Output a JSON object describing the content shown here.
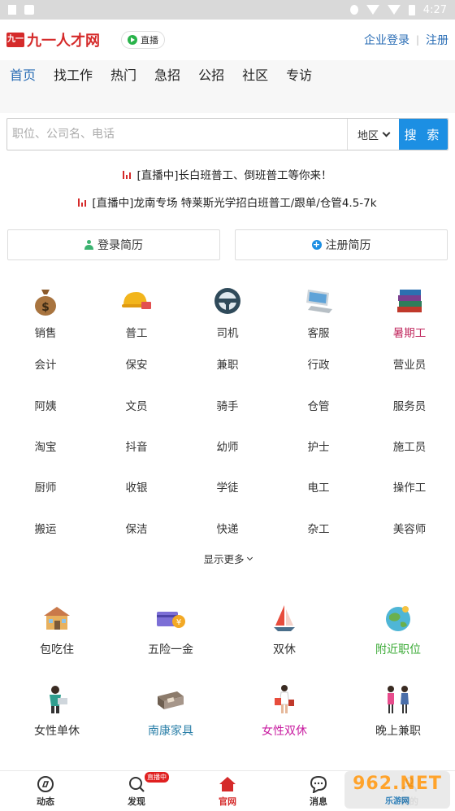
{
  "status_bar": {
    "time": "4:27"
  },
  "header": {
    "logo_mark": "九一",
    "logo_text": "九一人才网",
    "live_label": "直播",
    "company_login": "企业登录",
    "separator": "|",
    "register": "注册"
  },
  "nav": [
    "首页",
    "找工作",
    "热门",
    "急招",
    "公招",
    "社区",
    "专访"
  ],
  "search": {
    "placeholder": "职位、公司名、电话",
    "region_label": "地区",
    "button_label": "搜 索"
  },
  "broadcasts": [
    "[直播中]长白班普工、倒班普工等你来！",
    "[直播中]龙南专场 特莱斯光学招白班普工/跟单/仓管4.5-7k"
  ],
  "resume": {
    "login": "登录简历",
    "register": "注册简历"
  },
  "icon_categories": [
    {
      "label": "销售",
      "icon": "money-bag-icon"
    },
    {
      "label": "普工",
      "icon": "hard-hat-icon"
    },
    {
      "label": "司机",
      "icon": "steering-wheel-icon"
    },
    {
      "label": "客服",
      "icon": "computer-icon"
    },
    {
      "label": "暑期工",
      "icon": "books-icon"
    }
  ],
  "text_categories": [
    [
      "会计",
      "保安",
      "兼职",
      "行政",
      "营业员"
    ],
    [
      "阿姨",
      "文员",
      "骑手",
      "仓管",
      "服务员"
    ],
    [
      "淘宝",
      "抖音",
      "幼师",
      "护士",
      "施工员"
    ],
    [
      "厨师",
      "收银",
      "学徒",
      "电工",
      "操作工"
    ],
    [
      "搬运",
      "保洁",
      "快递",
      "杂工",
      "美容师"
    ]
  ],
  "show_more": "显示更多",
  "perks": [
    {
      "label": "包吃住",
      "icon": "house-icon"
    },
    {
      "label": "五险一金",
      "icon": "card-icon"
    },
    {
      "label": "双休",
      "icon": "sailboat-icon"
    },
    {
      "label": "附近职位",
      "icon": "globe-icon"
    },
    {
      "label": "女性单休",
      "icon": "woman-laptop-icon"
    },
    {
      "label": "南康家具",
      "icon": "sofa-icon"
    },
    {
      "label": "女性双休",
      "icon": "woman-shopping-icon"
    },
    {
      "label": "晚上兼职",
      "icon": "people-icon"
    }
  ],
  "tabbar": {
    "items": [
      "动态",
      "发现",
      "官网",
      "消息",
      "我的"
    ],
    "badge": "直播中"
  },
  "watermark": {
    "top": "962.NET",
    "bottom": "乐游网"
  },
  "colors": {
    "brand_red": "#d52a2a",
    "link_blue": "#2a6db5",
    "search_blue": "#1c8fe3"
  }
}
